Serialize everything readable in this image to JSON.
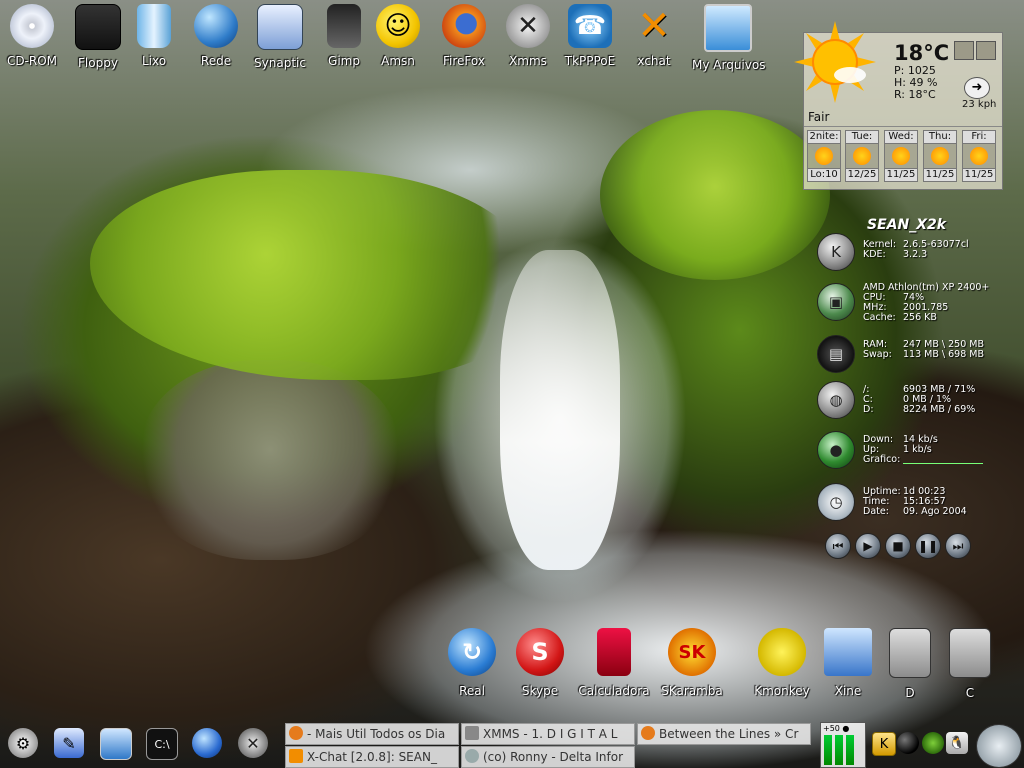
{
  "desktop_icons_top": [
    {
      "label": "CD-ROM",
      "icon": "cdrom-icon"
    },
    {
      "label": "Floppy",
      "icon": "floppy-icon"
    },
    {
      "label": "Lixo",
      "icon": "trash-icon"
    },
    {
      "label": "Rede",
      "icon": "network-icon"
    },
    {
      "label": "Synaptic",
      "icon": "synaptic-icon"
    },
    {
      "label": "Gimp",
      "icon": "gimp-icon"
    },
    {
      "label": "Amsn",
      "icon": "amsn-icon"
    },
    {
      "label": "FireFox",
      "icon": "firefox-icon"
    },
    {
      "label": "Xmms",
      "icon": "xmms-icon"
    },
    {
      "label": "TkPPPoE",
      "icon": "phone-icon"
    },
    {
      "label": "xchat",
      "icon": "xchat-icon"
    },
    {
      "label": "My Arquivos",
      "icon": "monitor-icon"
    }
  ],
  "weather": {
    "temperature": "18°C",
    "pressure": "P: 1025",
    "humidity": "H: 49 %",
    "realfeel": "R: 18°C",
    "wind": "23 kph",
    "condition": "Fair",
    "forecast": [
      {
        "day": "2nite:",
        "low": "Lo:10"
      },
      {
        "day": "Tue:",
        "low": "12/25"
      },
      {
        "day": "Wed:",
        "low": "11/25"
      },
      {
        "day": "Thu:",
        "low": "11/25"
      },
      {
        "day": "Fri:",
        "low": "11/25"
      }
    ]
  },
  "sysmon": {
    "hostname": "SEAN_X2k",
    "kernel_label": "Kernel:",
    "kernel": "2.6.5-63077cl",
    "kde_label": "KDE:",
    "kde": "3.2.3",
    "cpu_model": "AMD Athlon(tm) XP 2400+",
    "cpu_label": "CPU:",
    "cpu": "74%",
    "mhz_label": "MHz:",
    "mhz": "2001.785",
    "cache_label": "Cache:",
    "cache": "256 KB",
    "ram_label": "RAM:",
    "ram": "247 MB \\ 250 MB",
    "swap_label": "Swap:",
    "swap": "113 MB \\ 698 MB",
    "disk_root_label": "/:",
    "disk_root": "6903 MB / 71%",
    "disk_c_label": "C:",
    "disk_c": "0 MB / 1%",
    "disk_d_label": "D:",
    "disk_d": "8224 MB / 69%",
    "down_label": "Down:",
    "down": "14 kb/s",
    "up_label": "Up:",
    "up": "1 kb/s",
    "graph_label": "Grafico:",
    "uptime_label": "Uptime:",
    "uptime": "1d 00:23",
    "time_label": "Time:",
    "time": "15:16:57",
    "date_label": "Date:",
    "date": "09. Ago 2004"
  },
  "media_controls": [
    "previous",
    "play",
    "stop",
    "pause",
    "next"
  ],
  "desktop_icons_bottom": [
    {
      "label": "Real",
      "icon": "real-icon"
    },
    {
      "label": "Skype",
      "icon": "skype-icon"
    },
    {
      "label": "Calculadora",
      "icon": "calculator-icon"
    },
    {
      "label": "SKaramba",
      "icon": "skaramba-icon"
    },
    {
      "label": "Kmonkey",
      "icon": "banana-icon"
    },
    {
      "label": "Xine",
      "icon": "xine-icon"
    },
    {
      "label": "D",
      "icon": "drive-icon"
    },
    {
      "label": "C",
      "icon": "drive-icon"
    }
  ],
  "taskbar": {
    "tasks": [
      {
        "label": "- Mais Util Todos os Dia"
      },
      {
        "label": "XMMS - 1. D I G I T A L"
      },
      {
        "label": "Between the Lines » Cr"
      },
      {
        "label": "X-Chat [2.0.8]: SEAN_"
      },
      {
        "label": "(co) Ronny - Delta Infor"
      }
    ],
    "cpu_load_label": "+50 ●"
  }
}
